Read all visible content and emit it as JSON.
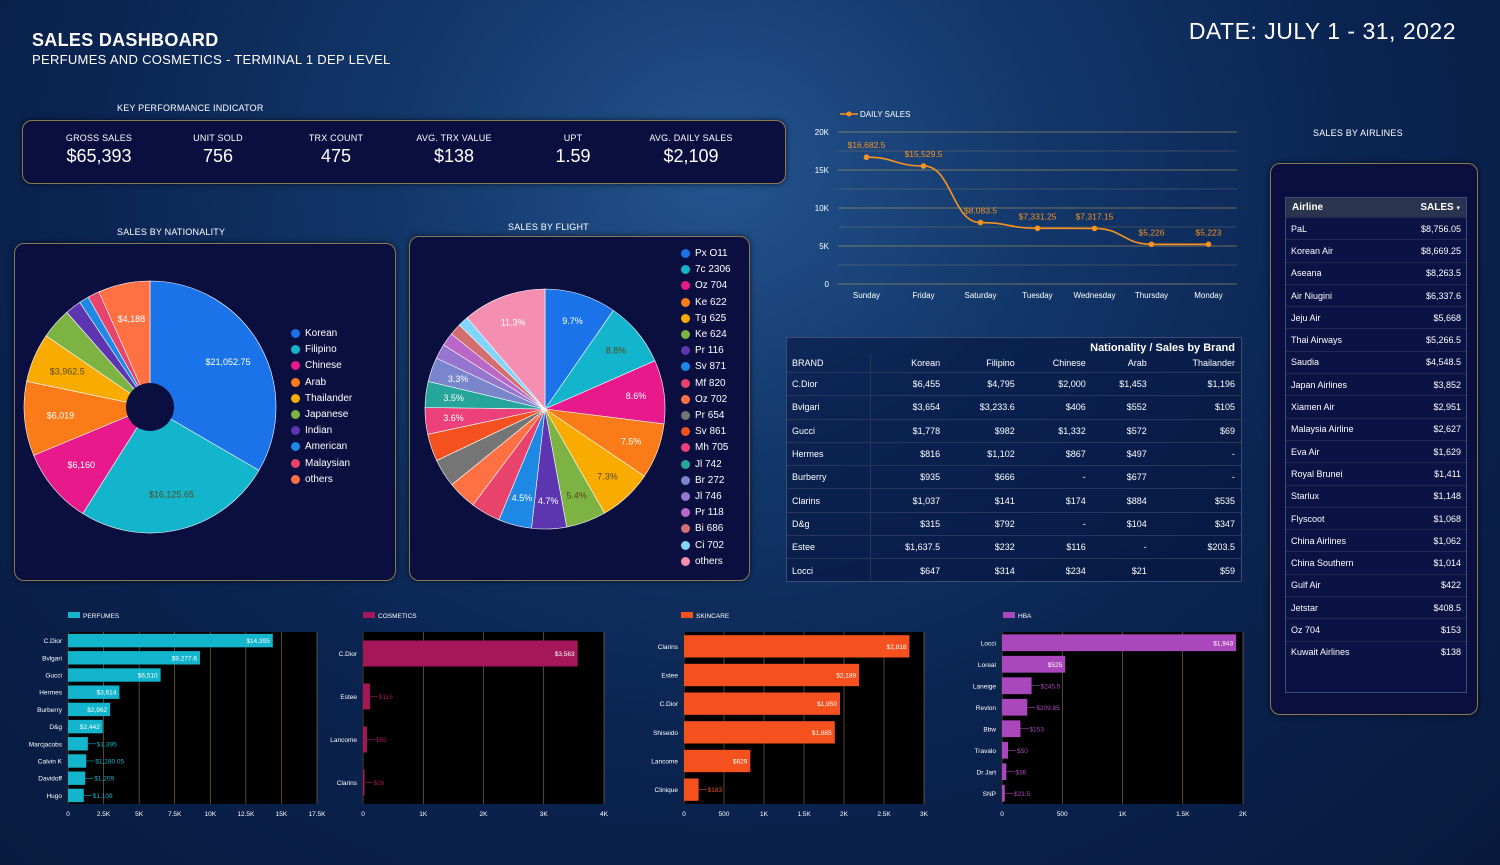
{
  "header": {
    "title": "SALES DASHBOARD",
    "subtitle": "PERFUMES AND COSMETICS - TERMINAL 1 DEP LEVEL",
    "date": "DATE: JULY  1 - 31, 2022"
  },
  "kpi": {
    "section_title": "KEY PERFORMANCE INDICATOR",
    "items": [
      {
        "label": "GROSS SALES",
        "value": "$65,393"
      },
      {
        "label": "UNIT SOLD",
        "value": "756"
      },
      {
        "label": "TRX COUNT",
        "value": "475"
      },
      {
        "label": "AVG. TRX VALUE",
        "value": "$138"
      },
      {
        "label": "UPT",
        "value": "1.59"
      },
      {
        "label": "AVG. DAILY SALES",
        "value": "$2,109"
      }
    ]
  },
  "colors": {
    "accent": "#f7931e",
    "panel_border": "#8a7a52",
    "perfumes": "#12b5cb",
    "cosmetics": "#a4175a",
    "skincare": "#f4511e",
    "hba": "#ab47bc"
  },
  "chart_data": [
    {
      "id": "daily",
      "type": "line",
      "legend": "DAILY SALES",
      "categories": [
        "Sunday",
        "Friday",
        "Saturday",
        "Tuesday",
        "Wednesday",
        "Thursday",
        "Monday"
      ],
      "values": [
        16682.5,
        15529.5,
        8083.5,
        7331.25,
        7317.15,
        5226,
        5223
      ],
      "labels": [
        "$16,682.5",
        "$15,529.5",
        "$8,083.5",
        "$7,331.25",
        "$7,317.15",
        "$5,226",
        "$5,223"
      ],
      "yticks": [
        "0",
        "5K",
        "10K",
        "15K",
        "20K"
      ],
      "ylim": [
        0,
        20000
      ],
      "color": "#f7931e"
    },
    {
      "id": "nationality",
      "type": "pie",
      "title": "SALES BY NATIONALITY",
      "donut": true,
      "labels": [
        "Korean",
        "Filipino",
        "Chinese",
        "Arab",
        "Thailander",
        "Japanese",
        "Indian",
        "American",
        "Malaysian",
        "others"
      ],
      "values": [
        21052.75,
        16125.65,
        6160,
        6019,
        3962.5,
        2500,
        1300,
        800,
        950,
        4188
      ],
      "value_labels": [
        "$21,052.75",
        "$16,125.65",
        "$6,160",
        "$6,019",
        "$3,962.5",
        "",
        "",
        "",
        "",
        "$4,188"
      ],
      "colors": [
        "#1a73e8",
        "#12b5cb",
        "#e8198b",
        "#fa7b17",
        "#f9ab00",
        "#7cb342",
        "#5e35b1",
        "#1e88e5",
        "#e8436a",
        "#ff7043"
      ]
    },
    {
      "id": "flight",
      "type": "pie",
      "title": "SALES BY  FLIGHT",
      "labels": [
        "Px O11",
        "7c 2306",
        "Oz 704",
        "Ke 622",
        "Tg 625",
        "Ke 624",
        "Pr 116",
        "Sv 871",
        "Mf 820",
        "Oz 702",
        "Pr 654",
        "Sv 861",
        "Mh 705",
        "Jl 742",
        "Br 272",
        "Jl 746",
        "Pr 118",
        "Bi 686",
        "Ci 702",
        "others"
      ],
      "values": [
        9.7,
        8.8,
        8.6,
        7.5,
        7.3,
        5.4,
        4.7,
        4.5,
        4.0,
        3.9,
        3.8,
        3.7,
        3.6,
        3.5,
        3.3,
        2.0,
        1.8,
        1.6,
        1.4,
        11.3
      ],
      "value_labels": [
        "9.7%",
        "8.8%",
        "8.6%",
        "7.5%",
        "7.3%",
        "5.4%",
        "4.7%",
        "4.5%",
        "",
        "",
        "",
        "",
        "3.6%",
        "3.5%",
        "3.3%",
        "",
        "",
        "",
        "",
        "11.3%"
      ],
      "colors": [
        "#1a73e8",
        "#12b5cb",
        "#e8198b",
        "#fa7b17",
        "#f9ab00",
        "#7cb342",
        "#5e35b1",
        "#1e88e5",
        "#e8436a",
        "#ff7043",
        "#757575",
        "#f4511e",
        "#ec407a",
        "#26a69a",
        "#7986cb",
        "#9575cd",
        "#ba68c8",
        "#d36e70",
        "#81d4fa",
        "#f48fb1"
      ]
    },
    {
      "id": "perfumes",
      "type": "bar",
      "legend": "PERFUMES",
      "color": "#12b5cb",
      "categories": [
        "C.Dior",
        "Bvlgari",
        "Gucci",
        "Hermes",
        "Burberry",
        "D&g",
        "Marcjacobs",
        "Calvin K",
        "Davidoff",
        "Hugo"
      ],
      "values": [
        14395,
        9277.6,
        6510,
        3614,
        2962,
        2442,
        1395,
        1280.05,
        1209,
        1109
      ],
      "labels": [
        "$14,395",
        "$9,277.6",
        "$6,510",
        "$3,614",
        "$2,962",
        "$2,442",
        "$1,395",
        "$1,280.05",
        "$1,209",
        "$1,109"
      ],
      "xticks": [
        "0",
        "2.5K",
        "5K",
        "7.5K",
        "10K",
        "12.5K",
        "15K",
        "17.5K"
      ],
      "xlim": [
        0,
        17500
      ]
    },
    {
      "id": "cosmetics",
      "type": "bar",
      "legend": "COSMETICS",
      "color": "#a4175a",
      "categories": [
        "C.Dior",
        "Estee",
        "Lancome",
        "Clarins"
      ],
      "values": [
        3563,
        115,
        65,
        26
      ],
      "labels": [
        "$3,563",
        "$115",
        "$65",
        "$26"
      ],
      "xticks": [
        "0",
        "1K",
        "2K",
        "3K",
        "4K"
      ],
      "xlim": [
        0,
        4000
      ]
    },
    {
      "id": "skincare",
      "type": "bar",
      "legend": "SKINCARE",
      "color": "#f4511e",
      "categories": [
        "Clarins",
        "Estee",
        "C.Dior",
        "Shiseido",
        "Lancome",
        "Clinique"
      ],
      "values": [
        2818,
        2189,
        1950,
        1885,
        829,
        183
      ],
      "labels": [
        "$2,818",
        "$2,189",
        "$1,950",
        "$1,885",
        "$829",
        "$183"
      ],
      "xticks": [
        "0",
        "500",
        "1K",
        "1.5K",
        "2K",
        "2.5K",
        "3K"
      ],
      "xlim": [
        0,
        3000
      ]
    },
    {
      "id": "hba",
      "type": "bar",
      "legend": "HBA",
      "color": "#ab47bc",
      "categories": [
        "Locci",
        "Loreal",
        "Laneige",
        "Revlon",
        "Bbw",
        "Travalo",
        "Dr Jart",
        "SNP"
      ],
      "values": [
        1943,
        525,
        245.5,
        209.85,
        153,
        50,
        36,
        23.5
      ],
      "labels": [
        "$1,943",
        "$525",
        "$245.5",
        "$209.85",
        "$153",
        "$50",
        "$36",
        "$23.5"
      ],
      "xticks": [
        "0",
        "500",
        "1K",
        "1.5K",
        "2K"
      ],
      "xlim": [
        0,
        2000
      ]
    }
  ],
  "nat_brand": {
    "title": "Nationality / Sales by Brand",
    "headers": [
      "BRAND",
      "Korean",
      "Filipino",
      "Chinese",
      "Arab",
      "Thailander"
    ],
    "rows": [
      [
        "C.Dior",
        "$6,455",
        "$4,795",
        "$2,000",
        "$1,453",
        "$1,196"
      ],
      [
        "Bvlgari",
        "$3,654",
        "$3,233.6",
        "$406",
        "$552",
        "$105"
      ],
      [
        "Gucci",
        "$1,778",
        "$982",
        "$1,332",
        "$572",
        "$69"
      ],
      [
        "Hermes",
        "$816",
        "$1,102",
        "$867",
        "$497",
        "-"
      ],
      [
        "Burberry",
        "$935",
        "$666",
        "-",
        "$677",
        "-"
      ],
      [
        "Clarins",
        "$1,037",
        "$141",
        "$174",
        "$884",
        "$535"
      ],
      [
        "D&g",
        "$315",
        "$792",
        "-",
        "$104",
        "$347"
      ],
      [
        "Estee",
        "$1,637.5",
        "$232",
        "$116",
        "-",
        "$203.5"
      ],
      [
        "Locci",
        "$647",
        "$314",
        "$234",
        "$21",
        "$59"
      ]
    ]
  },
  "airlines": {
    "title": "SALES BY AIRLINES",
    "col_airline": "Airline",
    "col_sales": "SALES",
    "sort_icon": "sort-desc-icon",
    "rows": [
      [
        "PaL",
        "$8,756.05"
      ],
      [
        "Korean Air",
        "$8,669.25"
      ],
      [
        "Aseana",
        "$8,263.5"
      ],
      [
        "Air Niugini",
        "$6,337.6"
      ],
      [
        "Jeju Air",
        "$5,668"
      ],
      [
        "Thai Airways",
        "$5,266.5"
      ],
      [
        "Saudia",
        "$4,548.5"
      ],
      [
        "Japan Airlines",
        "$3,852"
      ],
      [
        "Xiamen Air",
        "$2,951"
      ],
      [
        "Malaysia Airline",
        "$2,627"
      ],
      [
        "Eva Air",
        "$1,629"
      ],
      [
        "Royal Brunei",
        "$1,411"
      ],
      [
        "Starlux",
        "$1,148"
      ],
      [
        "Flyscoot",
        "$1,068"
      ],
      [
        "China Airlines",
        "$1,062"
      ],
      [
        "China Southern",
        "$1,014"
      ],
      [
        "Gulf Air",
        "$422"
      ],
      [
        "Jetstar",
        "$408.5"
      ],
      [
        "Oz 704",
        "$153"
      ],
      [
        "Kuwait Airlines",
        "$138"
      ]
    ]
  }
}
